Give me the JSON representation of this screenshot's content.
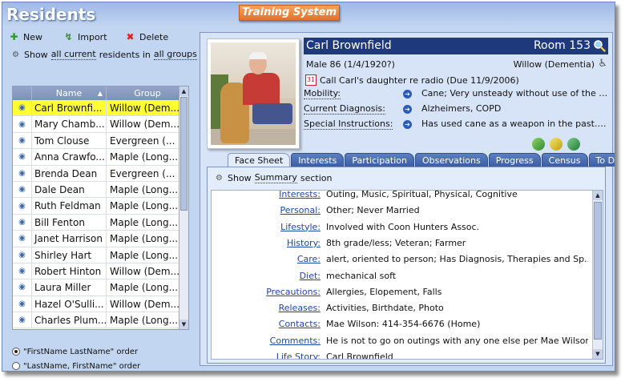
{
  "app": {
    "title": "Residents",
    "banner": "Training System"
  },
  "toolbar": {
    "new_label": "New",
    "import_label": "Import",
    "delete_label": "Delete"
  },
  "filter": {
    "show": "Show",
    "scope": "all current",
    "middle": "residents in",
    "groups": "all groups"
  },
  "list": {
    "columns": {
      "name": "Name",
      "group": "Group"
    },
    "rows": [
      {
        "name": "Carl Brownfi...",
        "group": "Willow (Dem..."
      },
      {
        "name": "Mary Chamb...",
        "group": "Willow (Dem..."
      },
      {
        "name": "Tom Clouse",
        "group": "Evergreen (..."
      },
      {
        "name": "Anna Crawfo...",
        "group": "Maple (Long..."
      },
      {
        "name": "Brenda Dean",
        "group": "Evergreen (..."
      },
      {
        "name": "Dale Dean",
        "group": "Maple (Long..."
      },
      {
        "name": "Ruth Feldman",
        "group": "Maple (Long..."
      },
      {
        "name": "Bill Fenton",
        "group": "Maple (Long..."
      },
      {
        "name": "Janet Harrison",
        "group": "Maple (Long..."
      },
      {
        "name": "Shirley Hart",
        "group": "Maple (Long..."
      },
      {
        "name": "Robert Hinton",
        "group": "Willow (Dem..."
      },
      {
        "name": "Laura Miller",
        "group": "Maple (Long..."
      },
      {
        "name": "Hazel O'Sulli...",
        "group": "Willow (Dem..."
      },
      {
        "name": "Charles Plum...",
        "group": "Maple (Long..."
      }
    ],
    "selected_index": 0
  },
  "order": {
    "first_last": "\"FirstName LastName\" order",
    "last_first": "\"LastName, FirstName\" order"
  },
  "resident": {
    "name": "Carl Brownfield",
    "room": "Room 153",
    "demographics": "Male 86 (1/4/1920?)",
    "unit": "Willow (Dementia)",
    "reminder": "Call Carl's daughter re radio (Due 11/9/2006)",
    "mobility_label": "Mobility:",
    "mobility": "Cane; Very unsteady without use of the ca...",
    "diagnosis_label": "Current Diagnosis:",
    "diagnosis": "Alzheimers, COPD",
    "instructions_label": "Special Instructions:",
    "instructions": "Has used cane as a weapon in the past. W..."
  },
  "tabs": [
    "Face Sheet",
    "Interests",
    "Participation",
    "Observations",
    "Progress",
    "Census",
    "To Do's"
  ],
  "summary": {
    "show": "Show",
    "mode": "Summary",
    "suffix": "section"
  },
  "fields": [
    {
      "label": "Interests:",
      "value": "Outing, Music, Spiritual, Physical, Cognitive"
    },
    {
      "label": "Personal:",
      "value": "Other; Never Married"
    },
    {
      "label": "Lifestyle:",
      "value": "Involved with Coon Hunters Assoc."
    },
    {
      "label": "History:",
      "value": "8th grade/less; Veteran; Farmer"
    },
    {
      "label": "Care:",
      "value": "alert, oriented to person; Has Diagnosis, Therapies and Sp..."
    },
    {
      "label": "Diet:",
      "value": "mechanical soft"
    },
    {
      "label": "Precautions:",
      "value": "Allergies, Elopement, Falls"
    },
    {
      "label": "Releases:",
      "value": "Activities, Birthdate, Photo"
    },
    {
      "label": "Contacts:",
      "value": "Mae  Wilson: 414-354-6676 (Home)"
    },
    {
      "label": "Comments:",
      "value": "He is not to go on outings with any one else per Mae Wilson."
    },
    {
      "label": "Life Story:",
      "value": "Carl Brownfield"
    }
  ],
  "colors": {
    "accent": "#1e3a7c",
    "selected_row": "#ffff33",
    "link": "#1f44a8",
    "banner": "#e5712a"
  },
  "icons": [
    "plus-icon",
    "import-icon",
    "delete-icon",
    "filter-icon",
    "resident-icon",
    "search-icon",
    "person-icon",
    "reminder-icon",
    "arrow-right-icon",
    "pill-icon"
  ]
}
